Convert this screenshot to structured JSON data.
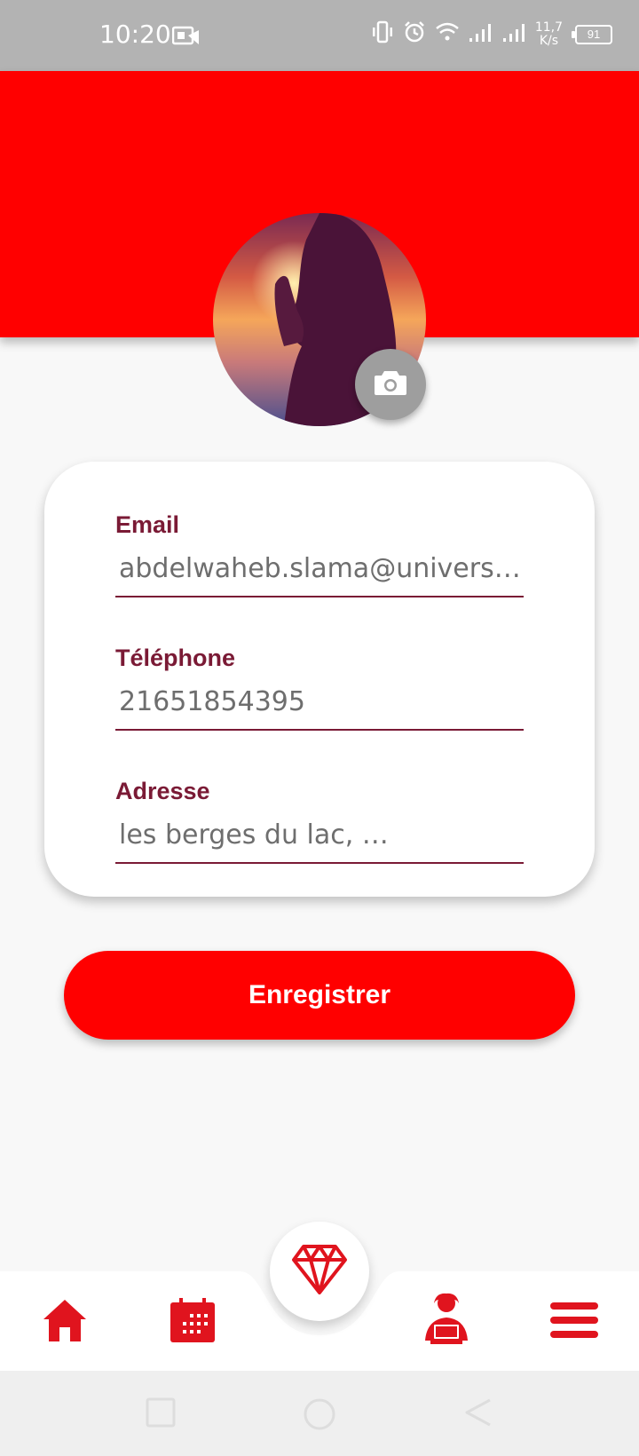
{
  "status_bar": {
    "time": "10:20",
    "net_speed_value": "11,7",
    "net_speed_unit": "K/s",
    "battery": "91"
  },
  "profile": {
    "avatar_icon": "profile-photo",
    "camera_icon": "camera-icon"
  },
  "form": {
    "email_label": "Email",
    "email_value": "abdelwaheb.slama@universite…",
    "phone_label": "Téléphone",
    "phone_value": "21651854395",
    "address_label": "Adresse",
    "address_value": "les berges du lac, …"
  },
  "save_button": "Enregistrer",
  "bottom_nav": {
    "items": [
      "home-icon",
      "calendar-icon",
      "diamond-icon",
      "user-laptop-icon",
      "menu-icon"
    ]
  },
  "colors": {
    "primary": "#ff0000",
    "label": "#7a1a35",
    "status_bar": "#b3b3b3"
  }
}
